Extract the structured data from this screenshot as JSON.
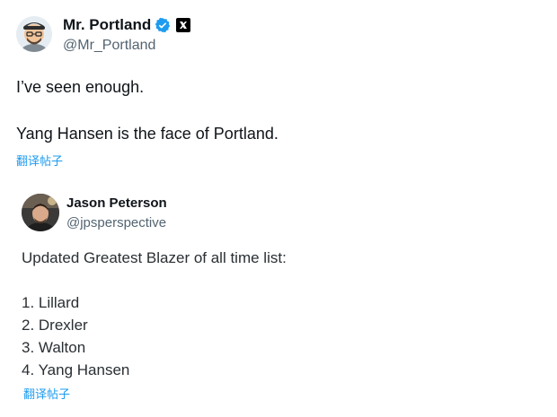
{
  "tweet": {
    "author": {
      "display_name": "Mr. Portland",
      "handle": "@Mr_Portland",
      "verified_icon": "verified-check-icon",
      "affiliate_icon": "affiliate-badge-icon"
    },
    "lines": [
      "I’ve seen enough.",
      "Yang Hansen is the face of Portland."
    ],
    "translate_label": "翻译帖子"
  },
  "quoted_tweet": {
    "author": {
      "display_name": "Jason Peterson",
      "handle": "@jpsperspective"
    },
    "intro": "Updated Greatest Blazer of all time list:",
    "list": [
      "1. Lillard",
      "2. Drexler",
      "3. Walton",
      "4. Yang Hansen"
    ],
    "translate_label": "翻译帖子"
  },
  "colors": {
    "accent": "#1d9bf0",
    "text": "#0f1419",
    "secondary": "#536471"
  }
}
